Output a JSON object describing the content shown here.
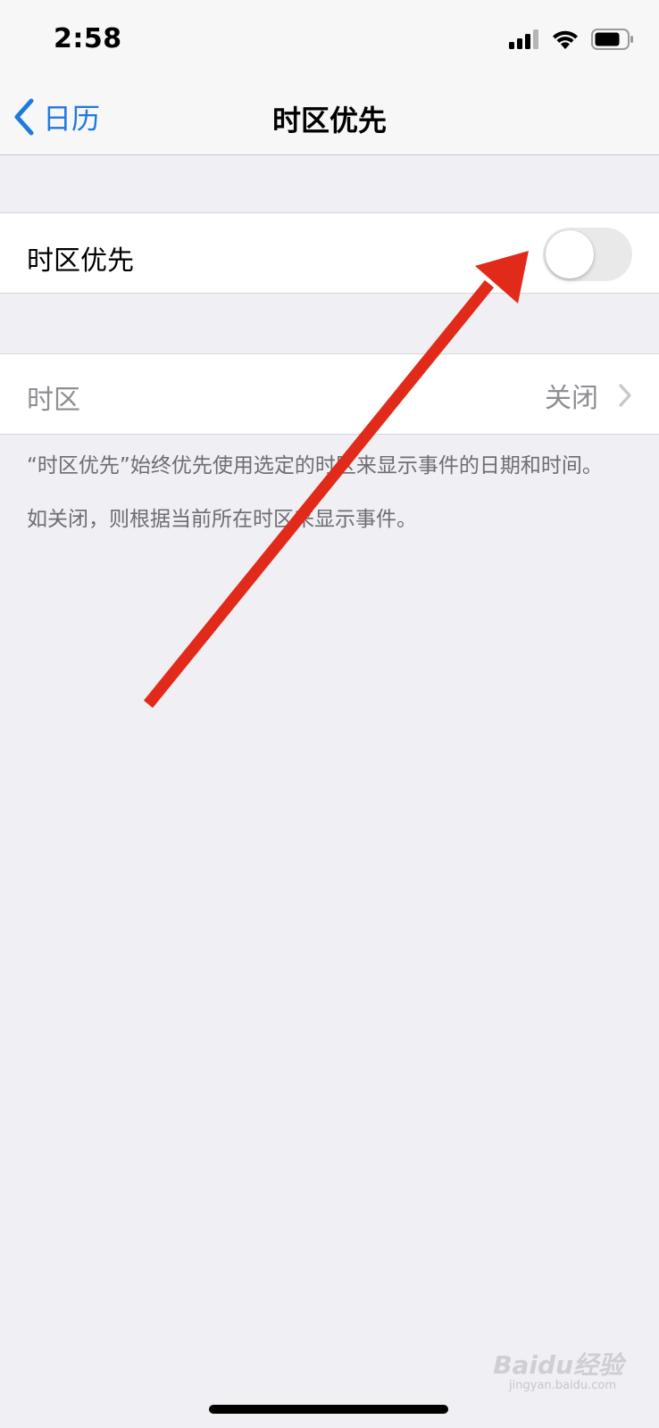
{
  "status_bar": {
    "time": "2:58",
    "icons": [
      "cellular-signal-icon",
      "wifi-icon",
      "battery-icon"
    ]
  },
  "nav": {
    "back_label": "日历",
    "title": "时区优先"
  },
  "toggle_row": {
    "label": "时区优先",
    "enabled": false
  },
  "timezone_row": {
    "label": "时区",
    "value": "关闭"
  },
  "footer": {
    "line1": "“时区优先”始终优先使用选定的时区来显示事件的日期和时间。",
    "line2": "如关闭，则根据当前所在时区来显示事件。"
  },
  "watermark": {
    "brand": "Baidu经验",
    "url": "jingyan.baidu.com"
  },
  "colors": {
    "accent": "#1f7ae0",
    "annotation_arrow": "#e12a1a",
    "background": "#efeff4"
  }
}
